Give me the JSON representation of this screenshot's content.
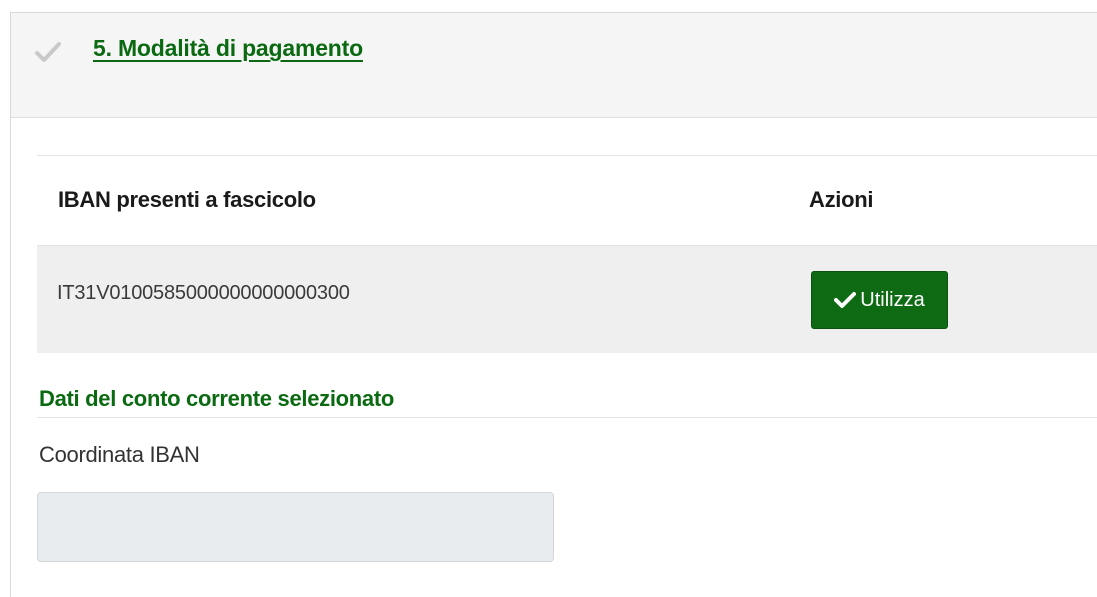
{
  "section": {
    "title": "5. Modalità di pagamento",
    "icon": "check-icon"
  },
  "table": {
    "headers": {
      "iban": "IBAN presenti a fascicolo",
      "actions": "Azioni"
    },
    "rows": [
      {
        "iban": "IT31V0100585000000000000300",
        "action_label": "Utilizza",
        "action_icon": "check-icon"
      }
    ]
  },
  "selected_account": {
    "title": "Dati del conto corrente selezionato",
    "iban_label": "Coordinata IBAN",
    "iban_value": ""
  },
  "colors": {
    "accent_green": "#0b6a11",
    "button_green": "#0e6b14",
    "header_bg": "#f5f5f5",
    "row_bg": "#efefef",
    "input_bg": "#e9ecef"
  }
}
